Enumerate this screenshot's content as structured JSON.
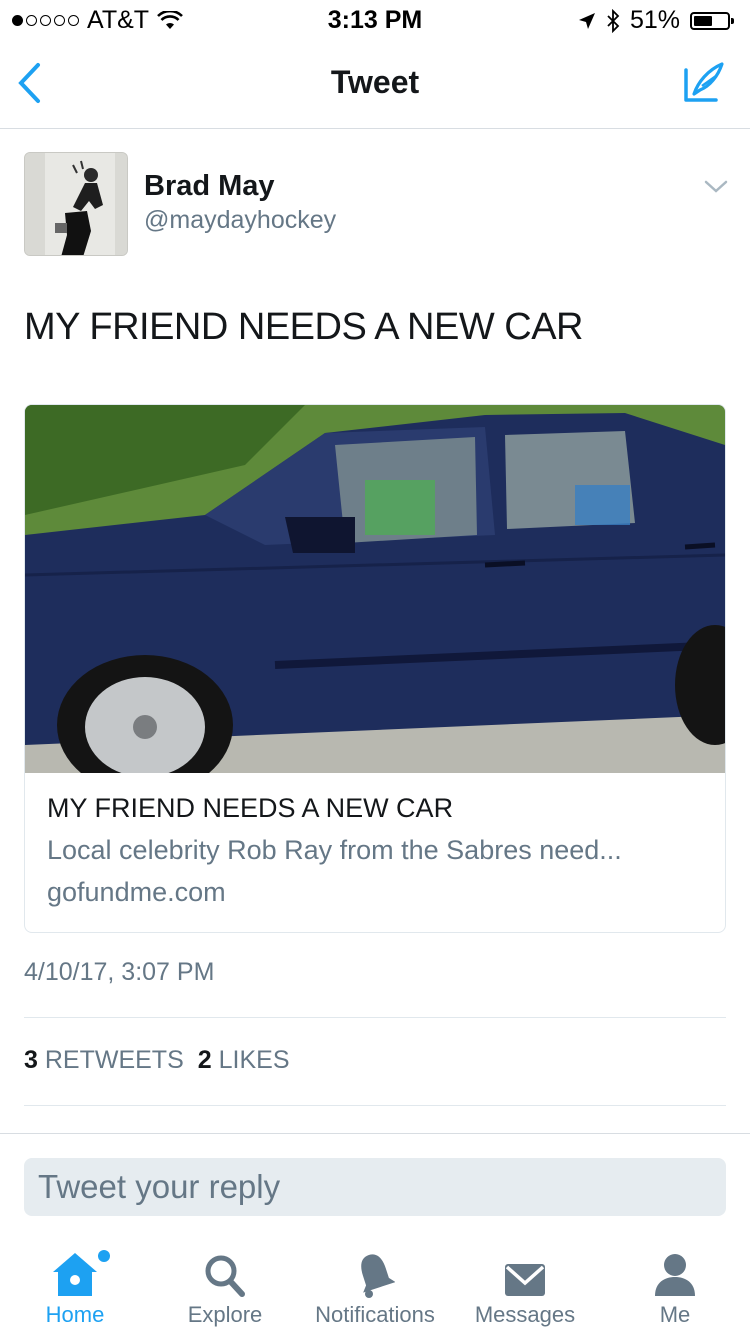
{
  "status_bar": {
    "carrier": "AT&T",
    "time": "3:13 PM",
    "battery": "51%",
    "signal_bars": 1
  },
  "nav": {
    "title": "Tweet"
  },
  "tweet": {
    "author_name": "Brad May",
    "author_handle": "@maydayhockey",
    "text": "MY FRIEND NEEDS A NEW CAR",
    "card": {
      "title": "MY FRIEND NEEDS A NEW CAR",
      "description": "Local celebrity Rob Ray from the Sabres need...",
      "domain": "gofundme.com"
    },
    "timestamp": "4/10/17, 3:07 PM",
    "retweets_count": "3",
    "retweets_label": "RETWEETS",
    "likes_count": "2",
    "likes_label": "LIKES"
  },
  "reply": {
    "placeholder": "Tweet your reply"
  },
  "tabs": [
    {
      "label": "Home",
      "icon": "home-icon",
      "active": true
    },
    {
      "label": "Explore",
      "icon": "search-icon",
      "active": false
    },
    {
      "label": "Notifications",
      "icon": "bell-icon",
      "active": false
    },
    {
      "label": "Messages",
      "icon": "envelope-icon",
      "active": false
    },
    {
      "label": "Me",
      "icon": "person-icon",
      "active": false
    }
  ],
  "colors": {
    "accent": "#1da1f2",
    "secondary_text": "#657786",
    "primary_text": "#14171a",
    "divider": "#e1e8ed"
  }
}
